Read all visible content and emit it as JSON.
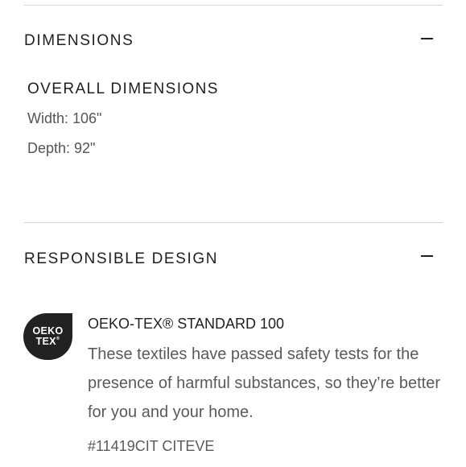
{
  "dimensions": {
    "title": "DIMENSIONS",
    "toggle_icon": "minus-icon",
    "overall_title": "OVERALL DIMENSIONS",
    "width": "Width: 106\"",
    "depth": "Depth: 92\""
  },
  "responsible_design": {
    "title": "RESPONSIBLE DESIGN",
    "toggle_icon": "minus-icon",
    "badge": {
      "line1": "OEKO",
      "line2": "TEX",
      "mark": "®",
      "color": "#222222"
    },
    "cert_title": "OEKO-TEX® STANDARD 100",
    "cert_description": "These textiles have passed safety tests for the presence of harmful substances, so they’re better for you and your home.",
    "cert_code": "#11419CIT CITEVE"
  }
}
